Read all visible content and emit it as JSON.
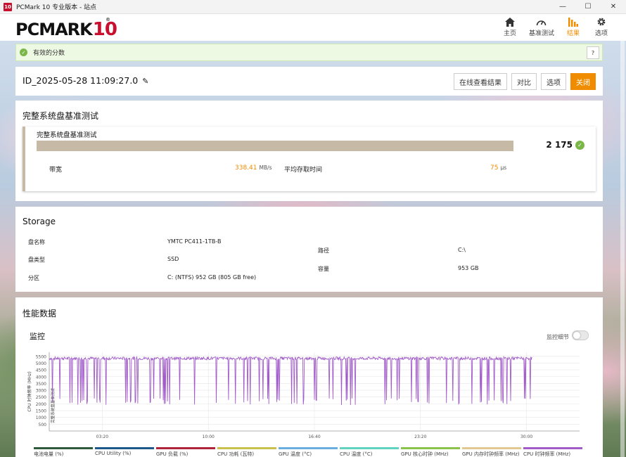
{
  "window": {
    "title": "PCMark 10 专业版本 - 站点",
    "icon_text": "10",
    "min": "—",
    "max": "☐",
    "close": "✕"
  },
  "logo": {
    "main": "PCMARK",
    "num": "10",
    "reg": "®"
  },
  "nav": [
    {
      "label": "主页",
      "icon": "home-icon"
    },
    {
      "label": "基准测试",
      "icon": "gauge-icon"
    },
    {
      "label": "结果",
      "icon": "bar-chart-icon"
    },
    {
      "label": "选项",
      "icon": "gear-icon"
    }
  ],
  "banner": {
    "text": "有效的分数",
    "help": "?"
  },
  "result": {
    "id": "ID_2025-05-28 11:09:27.0",
    "edit_icon": "✎",
    "buttons": {
      "online": "在线查看结果",
      "compare": "对比",
      "options": "选项",
      "close": "关闭"
    }
  },
  "benchmark": {
    "section_title": "完整系统盘基准测试",
    "card_title": "完整系统盘基准测试",
    "score": "2 175",
    "bandwidth_label": "带宽",
    "bandwidth_value": "338.41",
    "bandwidth_unit": "MB/s",
    "latency_label": "平均存取时间",
    "latency_value": "75",
    "latency_unit": "μs"
  },
  "storage": {
    "title": "Storage",
    "rows": [
      {
        "label": "盘名称",
        "value": "YMTC PC411-1TB-B"
      },
      {
        "label": "盘类型",
        "value": "SSD"
      },
      {
        "label": "分区",
        "value": "C: (NTFS) 952 GB (805 GB free)"
      }
    ],
    "right_rows": [
      {
        "label": "路径",
        "value": "C:\\"
      },
      {
        "label": "容量",
        "value": "953 GB"
      }
    ]
  },
  "performance": {
    "title": "性能数据",
    "monitor_title": "监控",
    "toggle_label": "监控细节"
  },
  "chart_data": {
    "type": "line",
    "ylabel": "CPU 时钟频率 (MHz)",
    "annotation": "完整系统盘基准测试",
    "y_ticks": [
      500,
      1000,
      1500,
      2000,
      2500,
      3000,
      3500,
      4000,
      4500,
      5000,
      5500
    ],
    "ylim": [
      0,
      5800
    ],
    "x_ticks": [
      "03:20",
      "10:00",
      "16:40",
      "23:20",
      "30:00"
    ],
    "x_tick_seconds": [
      200,
      600,
      1000,
      1400,
      1800
    ],
    "xlim": [
      0,
      2000
    ],
    "series_end_seconds": [
      0,
      1820
    ],
    "baseline": 5350,
    "dip_value": 1900,
    "color": "#a15cc9",
    "legend": [
      {
        "name": "电池电量 (%)",
        "color": "#2e5a3a"
      },
      {
        "name": "CPU Utility (%)",
        "color": "#1d5a8a"
      },
      {
        "name": "GPU 负载 (%)",
        "color": "#b0243a"
      },
      {
        "name": "CPU 功耗 (瓦特)",
        "color": "#c8c04a"
      },
      {
        "name": "GPU 温度 (°C)",
        "color": "#6aaee0"
      },
      {
        "name": "CPU 温度 (°C)",
        "color": "#5fd3c0"
      },
      {
        "name": "GPU 核心时钟 (MHz)",
        "color": "#8bc34a"
      },
      {
        "name": "GPU 内存时钟频率 (MHz)",
        "color": "#e0c890"
      },
      {
        "name": "CPU 时钟频率 (MHz)",
        "color": "#a15cc9"
      }
    ]
  }
}
